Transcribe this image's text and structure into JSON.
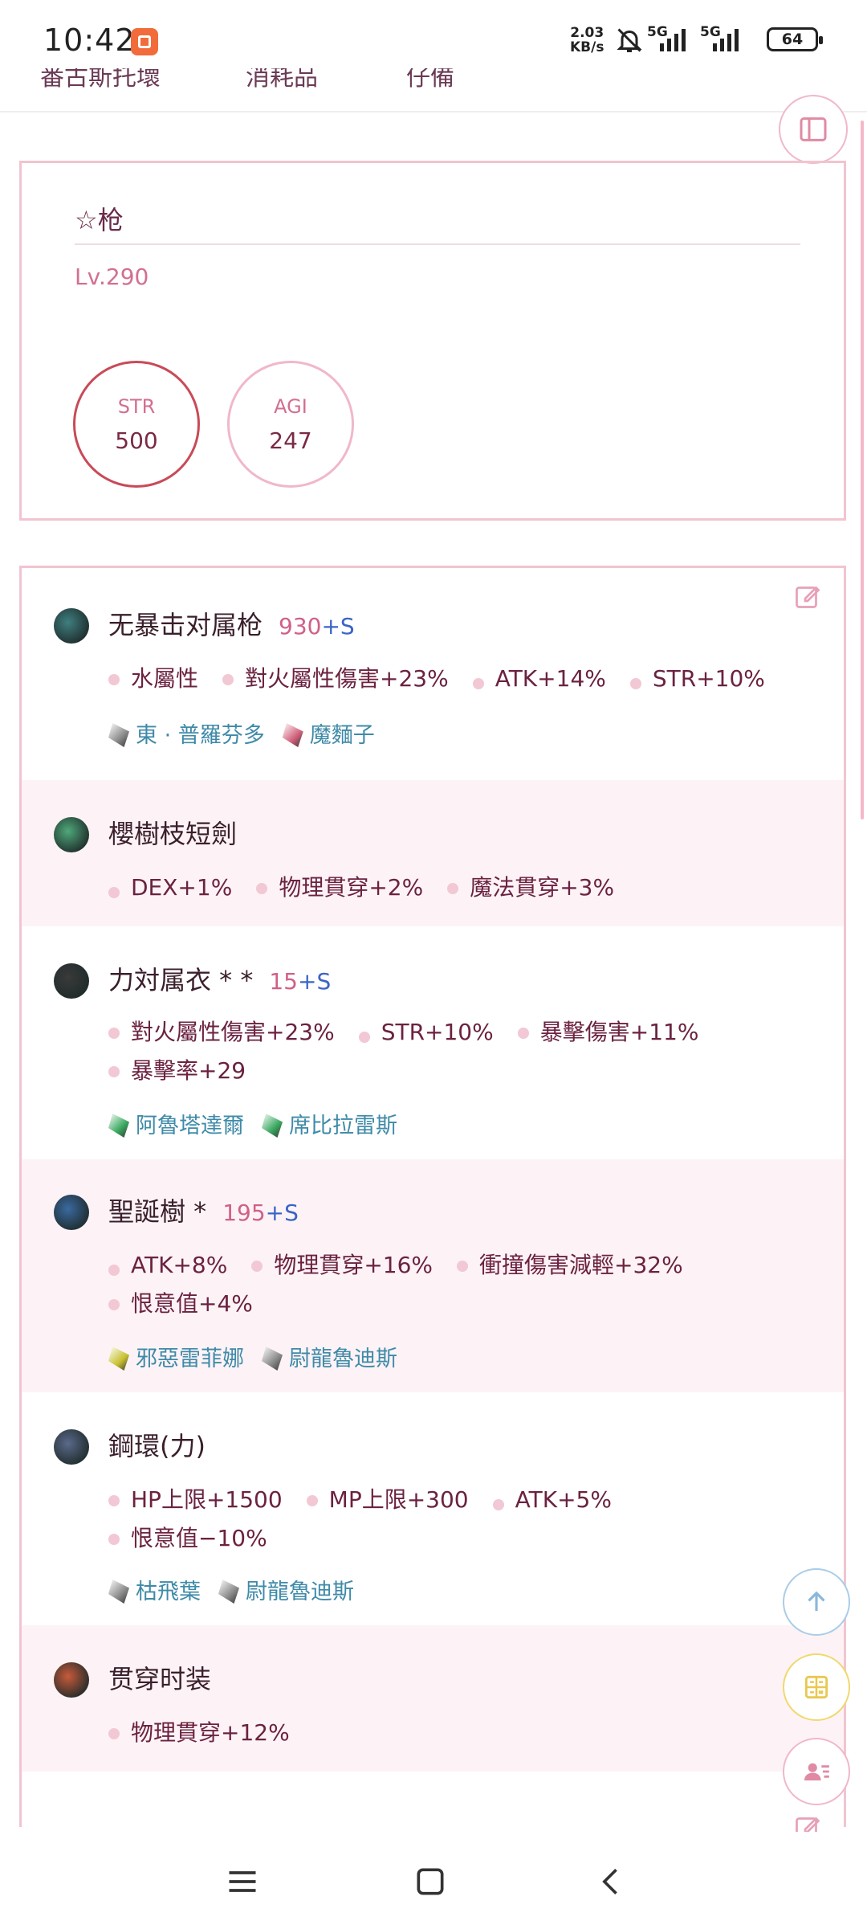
{
  "status_bar": {
    "time": "10:42",
    "speed_value": "2.03",
    "speed_unit": "KB/s",
    "network1": "5G",
    "network2": "5G",
    "battery": "64"
  },
  "tabs": [
    "番古斯托壞",
    "消耗品",
    "仔備"
  ],
  "character": {
    "name": "☆枪",
    "level": "Lv.290",
    "stats": [
      {
        "label": "STR",
        "value": "500"
      },
      {
        "label": "AGI",
        "value": "247"
      }
    ]
  },
  "equipment": [
    {
      "name": "无暴击对属枪",
      "refine": "930",
      "plus": "+S",
      "icon": "spear-icon",
      "stats": [
        [
          "水屬性",
          "對火屬性傷害+23%",
          "ATK+14%",
          "STR+10%"
        ]
      ],
      "cards": [
        {
          "name": "東 · 普羅芬多",
          "color": "#8a8a8a"
        },
        {
          "name": "魔麵子",
          "color": "#d0607a"
        }
      ]
    },
    {
      "name": "櫻樹枝短劍",
      "refine": "",
      "plus": "",
      "icon": "dagger-icon",
      "stats": [
        [
          "DEX+1%",
          "物理貫穿+2%",
          "魔法貫穿+3%"
        ]
      ],
      "cards": []
    },
    {
      "name": "力対属衣 * *",
      "refine": "15",
      "plus": "+S",
      "icon": "armor-icon",
      "stats": [
        [
          "對火屬性傷害+23%",
          "STR+10%",
          "暴擊傷害+11%"
        ],
        [
          "暴擊率+29"
        ]
      ],
      "cards": [
        {
          "name": "阿魯塔達爾",
          "color": "#3aa860"
        },
        {
          "name": "席比拉雷斯",
          "color": "#3aa860"
        }
      ]
    },
    {
      "name": "聖誕樹 *",
      "refine": "195",
      "plus": "+S",
      "icon": "hat-icon",
      "stats": [
        [
          "ATK+8%",
          "物理貫穿+16%",
          "衝撞傷害減輕+32%"
        ],
        [
          "恨意值+4%"
        ]
      ],
      "cards": [
        {
          "name": "邪惡雷菲娜",
          "color": "#c8c030"
        },
        {
          "name": "尉龍魯迪斯",
          "color": "#8a8a8a"
        }
      ]
    },
    {
      "name": "鋼環(力)",
      "refine": "",
      "plus": "",
      "icon": "ring-icon",
      "stats": [
        [
          "HP上限+1500",
          "MP上限+300",
          "ATK+5%"
        ],
        [
          "恨意值−10%"
        ]
      ],
      "cards": [
        {
          "name": "枯飛葉",
          "color": "#8a8a8a"
        },
        {
          "name": "尉龍魯迪斯",
          "color": "#8a8a8a"
        }
      ]
    },
    {
      "name": "贯穿时装",
      "refine": "",
      "plus": "",
      "icon": "bow-icon",
      "stats": [
        [
          "物理貫穿+12%"
        ]
      ],
      "cards": []
    }
  ]
}
